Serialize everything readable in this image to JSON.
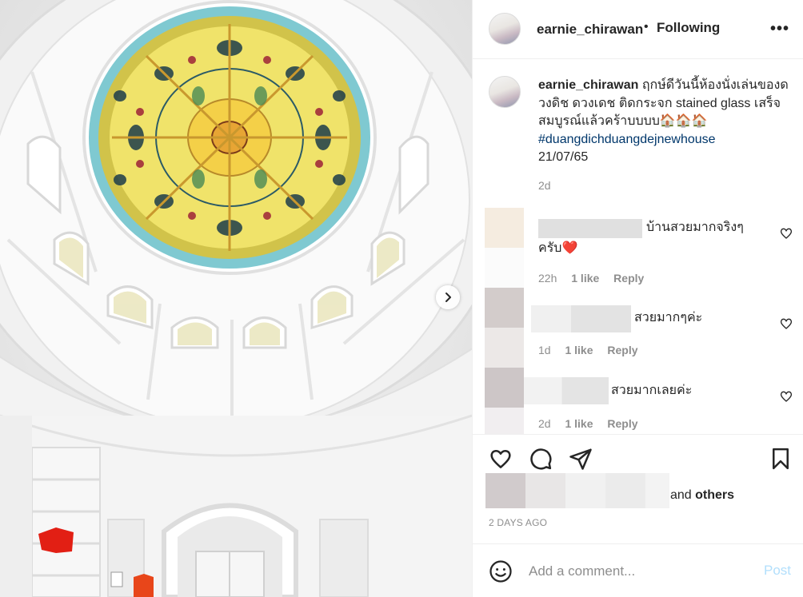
{
  "header": {
    "username": "earnie_chirawan",
    "separator": "•",
    "follow_status": "Following",
    "more_label": "•••",
    "more_icon": "more-options-icon"
  },
  "caption": {
    "username": "earnie_chirawan",
    "text": "ฤกษ์ดีวันนี้ห้องนั่งเล่นของดวงดิช ดวงเดช ติดกระจก stained glass เสร็จสมบูรณ์แล้วคร้าบบบบ🏠🏠🏠",
    "hashtag": "#duangdichduangdejnewhouse",
    "date_line": "21/07/65",
    "time": "2d"
  },
  "comments": [
    {
      "text": "บ้านสวยมากจริงๆ ครับ❤️",
      "time": "22h",
      "likes": "1 like",
      "reply": "Reply"
    },
    {
      "text": "สวยมากๆค่ะ",
      "time": "1d",
      "likes": "1 like",
      "reply": "Reply"
    },
    {
      "text": "สวยมากเลยค่ะ",
      "time": "2d",
      "likes": "1 like",
      "reply": "Reply"
    }
  ],
  "actions": {
    "icons": [
      "heart-icon",
      "comment-icon",
      "share-icon",
      "bookmark-icon"
    ],
    "likes_suffix_and": "and",
    "likes_suffix_others": "others",
    "posted_date": "2 DAYS AGO"
  },
  "add_comment": {
    "placeholder": "Add a comment...",
    "post_label": "Post",
    "emoji_icon": "emoji-icon"
  },
  "photo": {
    "next_icon": "chevron-right-icon"
  },
  "colors": {
    "text": "#262626",
    "muted": "#8e8e8e",
    "hashtag": "#00376b",
    "post_disabled": "#b2dffc",
    "divider": "#efefef"
  }
}
